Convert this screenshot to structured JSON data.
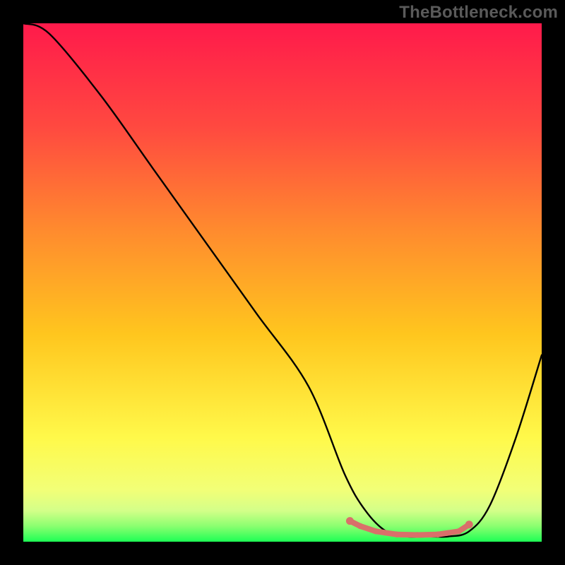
{
  "watermark": "TheBottleneck.com",
  "chart_data": {
    "type": "line",
    "title": "",
    "xlabel": "",
    "ylabel": "",
    "xlim": [
      0,
      100
    ],
    "ylim": [
      0,
      100
    ],
    "series": [
      {
        "name": "bottleneck-curve",
        "x": [
          0,
          5,
          15,
          25,
          35,
          45,
          55,
          62,
          66,
          70,
          74,
          78,
          82,
          86,
          90,
          95,
          100
        ],
        "values": [
          100,
          98,
          86,
          72,
          58,
          44,
          30,
          13,
          6,
          2,
          1,
          1,
          1,
          2,
          7,
          20,
          36
        ],
        "color": "#000000"
      },
      {
        "name": "optimal-range-markers",
        "x": [
          63,
          65,
          68,
          72,
          76,
          80,
          84,
          86
        ],
        "values": [
          4.0,
          3.0,
          2.0,
          1.4,
          1.3,
          1.4,
          2.0,
          3.3
        ],
        "color": "#d9706a"
      }
    ],
    "background_gradient_stops": [
      {
        "offset": 0.0,
        "color": "#ff1a4b"
      },
      {
        "offset": 0.2,
        "color": "#ff4940"
      },
      {
        "offset": 0.4,
        "color": "#ff8b2e"
      },
      {
        "offset": 0.6,
        "color": "#ffc61e"
      },
      {
        "offset": 0.8,
        "color": "#fff94a"
      },
      {
        "offset": 0.9,
        "color": "#f2ff77"
      },
      {
        "offset": 0.94,
        "color": "#d4ff89"
      },
      {
        "offset": 0.97,
        "color": "#8bff70"
      },
      {
        "offset": 1.0,
        "color": "#1eff55"
      }
    ]
  }
}
